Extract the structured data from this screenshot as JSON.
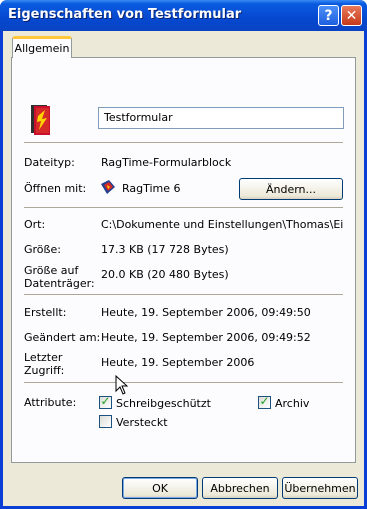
{
  "window": {
    "title": "Eigenschaften von Testformular",
    "help_label": "?",
    "close_label": "✕"
  },
  "tabs": [
    {
      "label": "Allgemein",
      "active": true
    }
  ],
  "general": {
    "file_name": "Testformular",
    "rows": {
      "type_label": "Dateityp:",
      "type_value": "RagTime-Formularblock",
      "opens_with_label": "Öffnen mit:",
      "opens_with_value": "RagTime 6",
      "change_button": "Ändern...",
      "location_label": "Ort:",
      "location_value": "C:\\Dokumente und Einstellungen\\Thomas\\Eigene D",
      "size_label": "Größe:",
      "size_value": "17.3 KB (17 728 Bytes)",
      "disk_size_label_1": "Größe auf",
      "disk_size_label_2": "Datenträger:",
      "disk_size_value": "20.0 KB (20 480 Bytes)",
      "created_label": "Erstellt:",
      "created_value": "Heute, 19. September 2006, 09:49:50",
      "modified_label": "Geändert am:",
      "modified_value": "Heute, 19. September 2006, 09:49:52",
      "accessed_label_1": "Letzter",
      "accessed_label_2": "Zugriff:",
      "accessed_value": "Heute, 19. September 2006"
    },
    "attributes": {
      "label": "Attribute:",
      "readonly": {
        "label": "Schreibgeschützt",
        "checked": true
      },
      "hidden": {
        "label": "Versteckt",
        "checked": false
      },
      "archive": {
        "label": "Archiv",
        "checked": true
      }
    }
  },
  "buttons": {
    "ok": "OK",
    "cancel": "Abbrechen",
    "apply": "Übernehmen"
  },
  "colors": {
    "titlebar": "#0548d0",
    "face": "#ece9d8",
    "panel": "#fcfcfe",
    "tab_accent": "#ffc83c",
    "check": "#21a121"
  }
}
